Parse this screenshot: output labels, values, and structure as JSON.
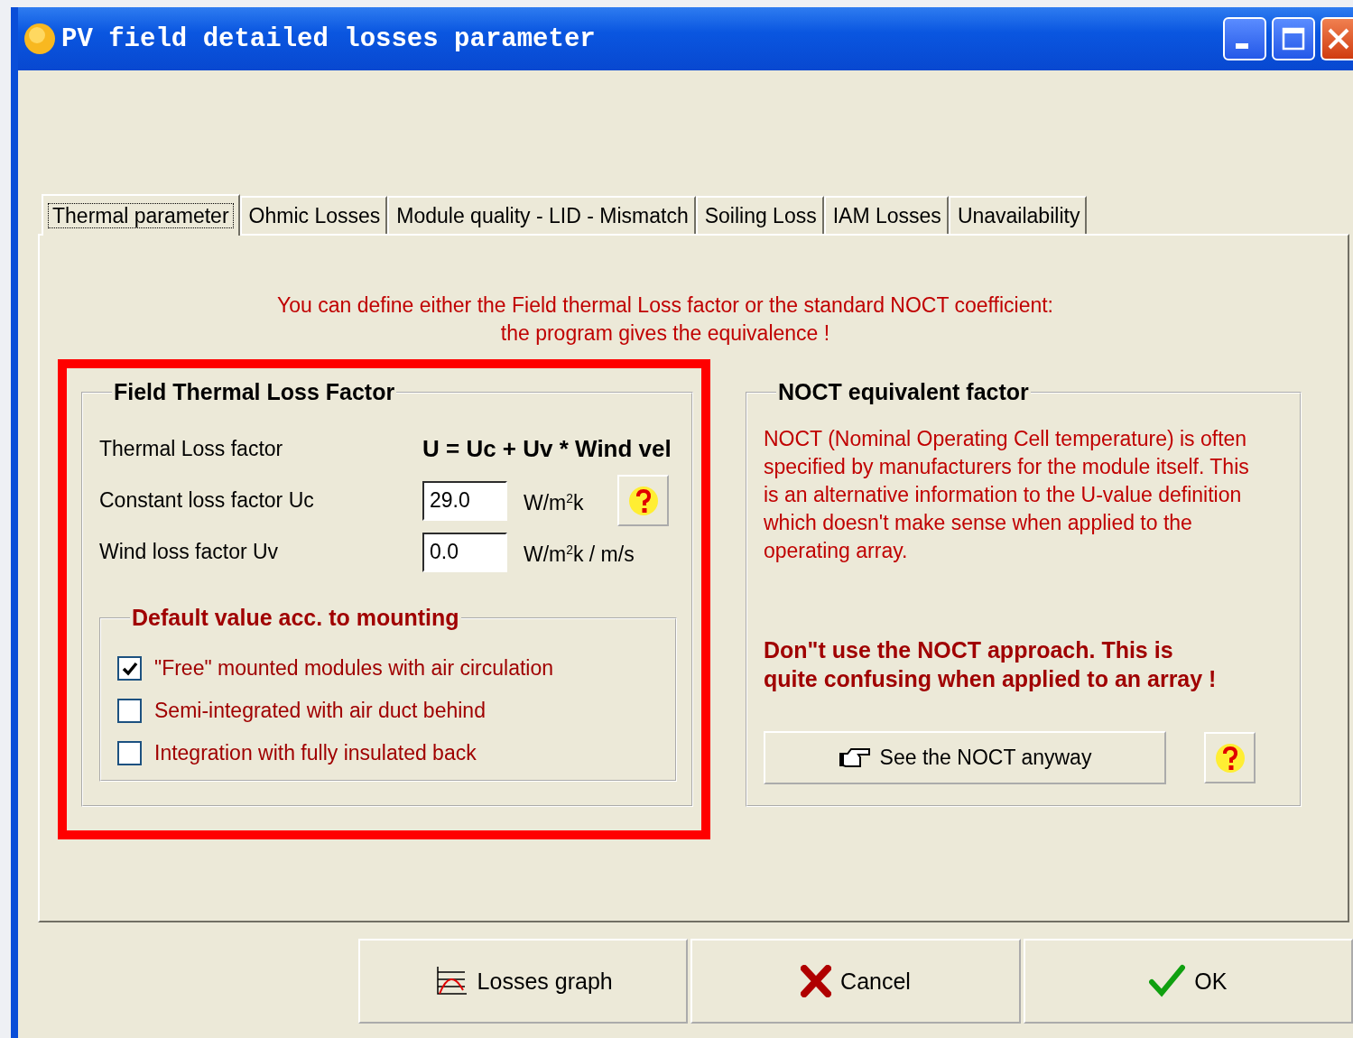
{
  "window": {
    "title": "PV field detailed losses parameter"
  },
  "tabs": [
    {
      "label": "Thermal parameter",
      "selected": true
    },
    {
      "label": "Ohmic Losses",
      "selected": false
    },
    {
      "label": "Module quality - LID - Mismatch",
      "selected": false
    },
    {
      "label": "Soiling Loss",
      "selected": false
    },
    {
      "label": "IAM Losses",
      "selected": false
    },
    {
      "label": "Unavailability",
      "selected": false
    }
  ],
  "intro": [
    "You can define either the Field thermal Loss factor or the standard NOCT coefficient:",
    "the program gives the equivalence !"
  ],
  "thermal_group": {
    "title": "Field Thermal Loss Factor",
    "formula_label": "Thermal Loss factor",
    "formula": "U = Uc + Uv * Wind vel",
    "fields": [
      {
        "label": "Constant loss factor  Uc",
        "value": "29.0",
        "unit": "W/m$^{2}$k",
        "help": true
      },
      {
        "label": "Wind loss factor  Uv",
        "value": "0.0",
        "unit": "W/m$^{2}$k / m/s",
        "help": false
      }
    ],
    "mounting": {
      "title": "Default value acc. to mounting",
      "options": [
        {
          "label": "\"Free\" mounted modules with air circulation",
          "checked": true
        },
        {
          "label": "Semi-integrated with air duct behind",
          "checked": false
        },
        {
          "label": "Integration with fully insulated back",
          "checked": false
        }
      ]
    }
  },
  "noct_group": {
    "title": "NOCT equivalent factor",
    "description": "NOCT  (Nominal Operating Cell temperature) is often specified by manufacturers  for the module itself. This is an alternative information to the U-value definition which doesn't make sense when applied to the operating array.",
    "warning": "Don\"t use the NOCT approach. This is quite confusing when applied to an array !",
    "button": {
      "label": "See the NOCT anyway"
    }
  },
  "buttons": [
    {
      "label": "Losses graph",
      "kind": "graph"
    },
    {
      "label": "Cancel",
      "kind": "cancel"
    },
    {
      "label": "OK",
      "kind": "ok"
    }
  ]
}
